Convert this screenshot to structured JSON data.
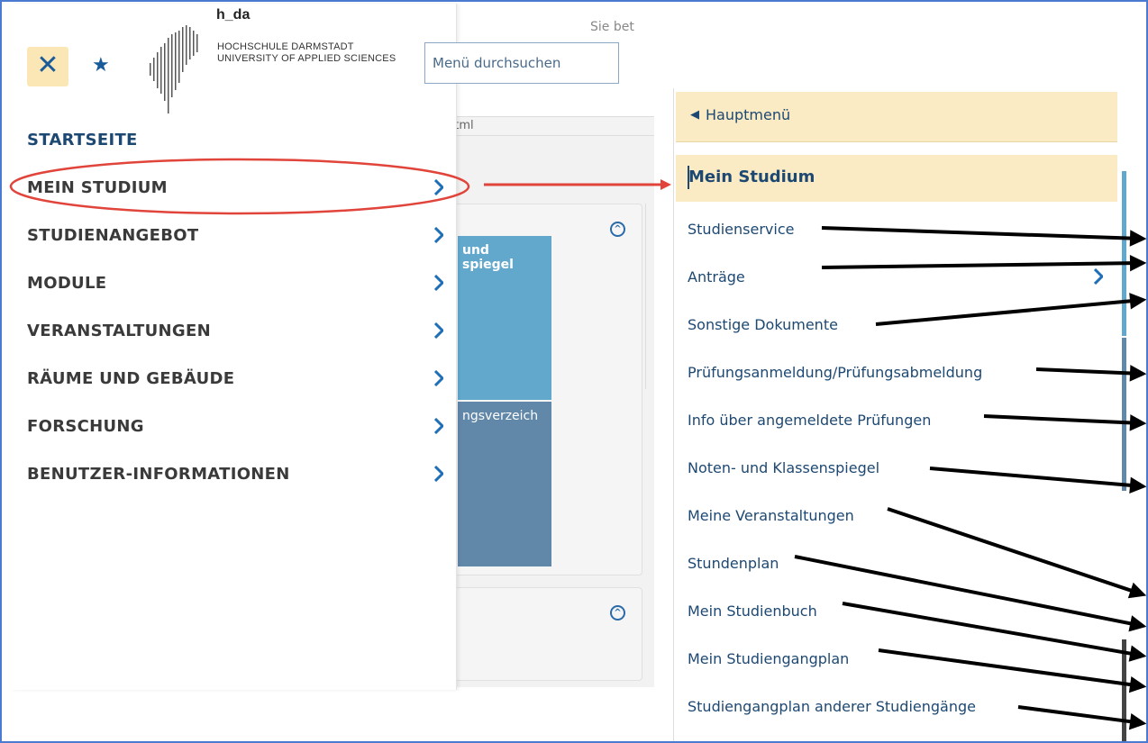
{
  "background_page": {
    "status_text": "Sie bet",
    "url_text": "html",
    "tile1_text": "und\nspiegel",
    "tile2_text": "ngsverzeich"
  },
  "logo": {
    "name": "h_da",
    "line1": "HOCHSCHULE DARMSTADT",
    "line2": "UNIVERSITY OF APPLIED SCIENCES"
  },
  "search": {
    "placeholder": "Menü durchsuchen"
  },
  "main_menu": {
    "items": [
      {
        "label": "STARTSEITE",
        "has_submenu": false
      },
      {
        "label": "MEIN STUDIUM",
        "has_submenu": true
      },
      {
        "label": "STUDIENANGEBOT",
        "has_submenu": true
      },
      {
        "label": "MODULE",
        "has_submenu": true
      },
      {
        "label": "VERANSTALTUNGEN",
        "has_submenu": true
      },
      {
        "label": "RÄUME UND GEBÄUDE",
        "has_submenu": true
      },
      {
        "label": "FORSCHUNG",
        "has_submenu": true
      },
      {
        "label": "BENUTZER-INFORMATIONEN",
        "has_submenu": true
      }
    ]
  },
  "sub_menu": {
    "back_label": "Hauptmenü",
    "title": "Mein Studium",
    "items": [
      {
        "label": "Studienservice",
        "has_submenu": false
      },
      {
        "label": "Anträge",
        "has_submenu": true
      },
      {
        "label": "Sonstige Dokumente",
        "has_submenu": false
      },
      {
        "label": "Prüfungsanmeldung/Prüfungsabmeldung",
        "has_submenu": false
      },
      {
        "label": "Info über angemeldete Prüfungen",
        "has_submenu": false
      },
      {
        "label": "Noten- und Klassenspiegel",
        "has_submenu": false
      },
      {
        "label": "Meine Veranstaltungen",
        "has_submenu": false
      },
      {
        "label": "Stundenplan",
        "has_submenu": false
      },
      {
        "label": "Mein Studienbuch",
        "has_submenu": false
      },
      {
        "label": "Mein Studiengangplan",
        "has_submenu": false
      },
      {
        "label": "Studiengangplan anderer Studiengänge",
        "has_submenu": false
      }
    ]
  },
  "colors": {
    "accent": "#1d4872",
    "chevron": "#1f6fb8",
    "highlight_bg": "#fbebc4",
    "annotation_red": "#e0443a",
    "annotation_black": "#000000"
  }
}
